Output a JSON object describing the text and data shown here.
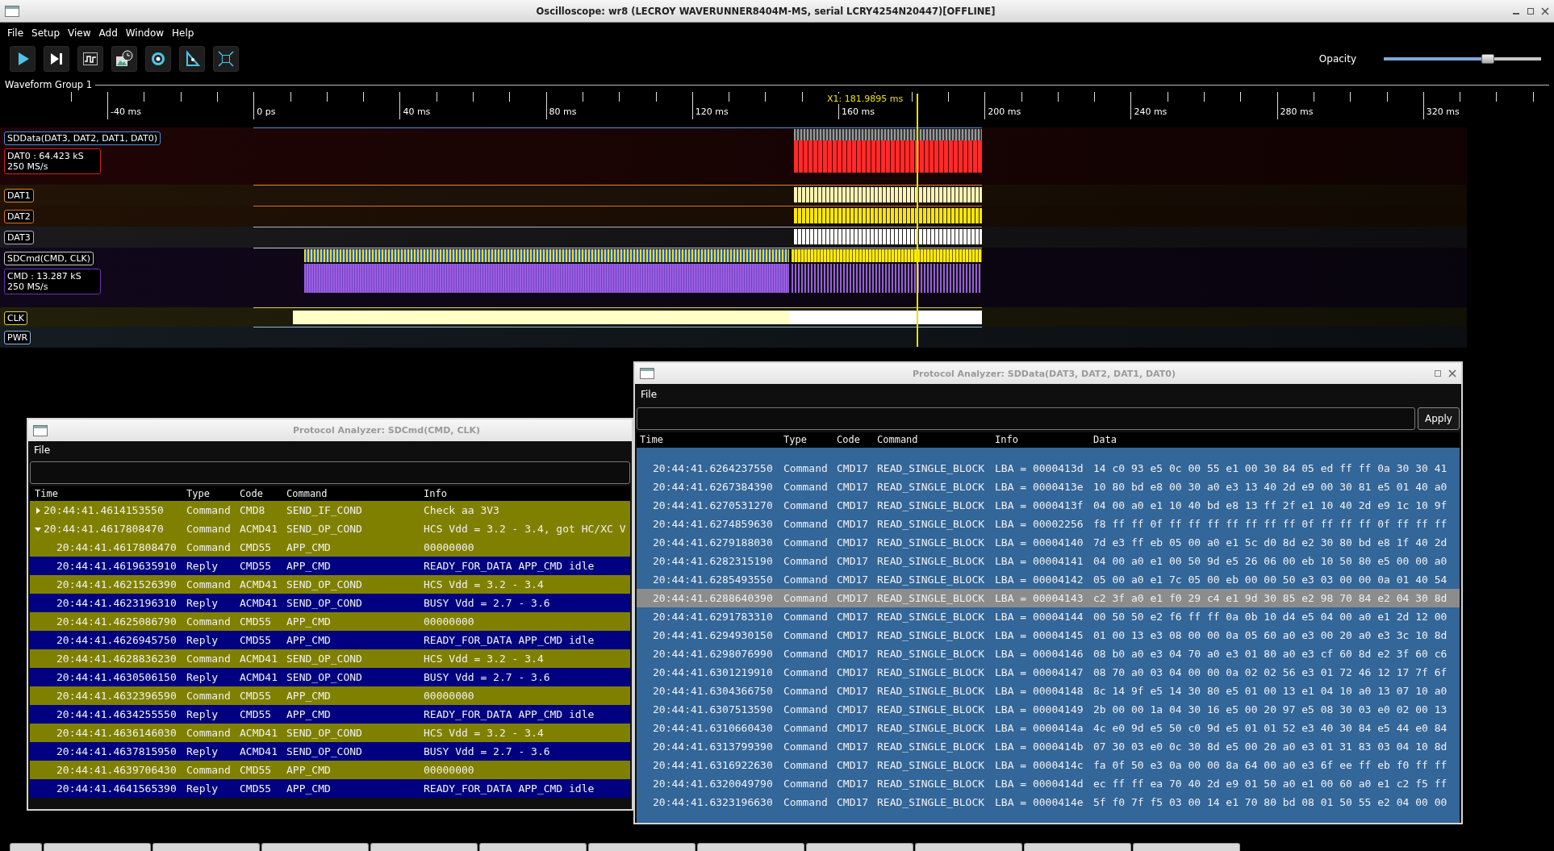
{
  "window": {
    "title": "Oscilloscope: wr8 (LECROY WAVERUNNER8404M-MS, serial LCRY4254N20447)[OFFLINE]"
  },
  "menu": [
    "File",
    "Setup",
    "View",
    "Add",
    "Window",
    "Help"
  ],
  "toolbar": {
    "opacity": {
      "label": "Opacity",
      "level": 0.66
    }
  },
  "waveform_group": {
    "title": "Waveform Group 1",
    "ruler": [
      "-40 ms",
      "0 ps",
      "40 ms",
      "80 ms",
      "120 ms",
      "160 ms",
      "200 ms",
      "240 ms",
      "280 ms",
      "320 ms"
    ],
    "cursor": {
      "label": "X1: 181.9895 ms"
    },
    "channels": [
      {
        "label": "SDData(DAT3, DAT2, DAT1, DAT0)",
        "kind": "data-bus",
        "color": "#4a90e2",
        "info": {
          "lines": [
            "DAT0 : 64.423 kS",
            "250 MS/s"
          ],
          "color": "#d42020"
        }
      },
      {
        "label": "DAT1",
        "kind": "data-line",
        "color": "#e08a30",
        "trace": {
          "color": "#fff3b0"
        }
      },
      {
        "label": "DAT2",
        "kind": "data-line",
        "color": "#e07020",
        "trace": {
          "color": "#ffe600"
        }
      },
      {
        "label": "DAT3",
        "kind": "data-line",
        "color": "#b0b0c8",
        "trace": {
          "color": "#ffffff"
        }
      },
      {
        "label": "SDCmd(CMD, CLK)",
        "kind": "cmd-bus",
        "color": "#c8c8c8",
        "info": {
          "lines": [
            "CMD : 13.287 kS",
            "250 MS/s"
          ],
          "color": "#6a34b0"
        }
      },
      {
        "label": "CLK",
        "kind": "clock",
        "color": "#e0d040"
      },
      {
        "label": "PWR",
        "kind": "power",
        "color": "#8ab8e0"
      }
    ]
  },
  "analyzers": [
    {
      "title": "Protocol Analyzer: SDCmd(CMD, CLK)",
      "menu": [
        "File"
      ],
      "columns": [
        "Time",
        "Type",
        "Code",
        "Command",
        "Info"
      ],
      "rows": [
        {
          "time": "20:44:41.4614153550",
          "type": "Command",
          "code": "CMD8",
          "command": "SEND_IF_COND",
          "info": "Check aa 3V3",
          "color": "#808000",
          "expanded": false
        },
        {
          "time": "20:44:41.4617808470",
          "type": "Command",
          "code": "ACMD41",
          "command": "SEND_OP_COND",
          "info": "HCS Vdd = 3.2 - 3.4, got HC/XC V",
          "color": "#808000",
          "expanded": true,
          "children": [
            {
              "time": "20:44:41.4617808470",
              "type": "Command",
              "code": "CMD55",
              "command": "APP_CMD",
              "info": "00000000",
              "color": "#808000"
            },
            {
              "time": "20:44:41.4619635910",
              "type": "Reply",
              "code": "CMD55",
              "command": "APP_CMD",
              "info": "READY_FOR_DATA APP_CMD idle",
              "color": "#000080"
            },
            {
              "time": "20:44:41.4621526390",
              "type": "Command",
              "code": "ACMD41",
              "command": "SEND_OP_COND",
              "info": "HCS Vdd = 3.2 - 3.4",
              "color": "#808000"
            },
            {
              "time": "20:44:41.4623196310",
              "type": "Reply",
              "code": "ACMD41",
              "command": "SEND_OP_COND",
              "info": "BUSY Vdd = 2.7 - 3.6",
              "color": "#000080"
            },
            {
              "time": "20:44:41.4625086790",
              "type": "Command",
              "code": "CMD55",
              "command": "APP_CMD",
              "info": "00000000",
              "color": "#808000"
            },
            {
              "time": "20:44:41.4626945750",
              "type": "Reply",
              "code": "CMD55",
              "command": "APP_CMD",
              "info": "READY_FOR_DATA APP_CMD idle",
              "color": "#000080"
            },
            {
              "time": "20:44:41.4628836230",
              "type": "Command",
              "code": "ACMD41",
              "command": "SEND_OP_COND",
              "info": "HCS Vdd = 3.2 - 3.4",
              "color": "#808000"
            },
            {
              "time": "20:44:41.4630506150",
              "type": "Reply",
              "code": "ACMD41",
              "command": "SEND_OP_COND",
              "info": "BUSY Vdd = 2.7 - 3.6",
              "color": "#000080"
            },
            {
              "time": "20:44:41.4632396590",
              "type": "Command",
              "code": "CMD55",
              "command": "APP_CMD",
              "info": "00000000",
              "color": "#808000"
            },
            {
              "time": "20:44:41.4634255550",
              "type": "Reply",
              "code": "CMD55",
              "command": "APP_CMD",
              "info": "READY_FOR_DATA APP_CMD idle",
              "color": "#000080"
            },
            {
              "time": "20:44:41.4636146030",
              "type": "Command",
              "code": "ACMD41",
              "command": "SEND_OP_COND",
              "info": "HCS Vdd = 3.2 - 3.4",
              "color": "#808000"
            },
            {
              "time": "20:44:41.4637815950",
              "type": "Reply",
              "code": "ACMD41",
              "command": "SEND_OP_COND",
              "info": "BUSY Vdd = 2.7 - 3.6",
              "color": "#000080"
            },
            {
              "time": "20:44:41.4639706430",
              "type": "Command",
              "code": "CMD55",
              "command": "APP_CMD",
              "info": "00000000",
              "color": "#808000"
            },
            {
              "time": "20:44:41.4641565390",
              "type": "Reply",
              "code": "CMD55",
              "command": "APP_CMD",
              "info": "READY_FOR_DATA APP_CMD idle",
              "color": "#000080"
            }
          ]
        }
      ]
    },
    {
      "title": "Protocol Analyzer: SDData(DAT3, DAT2, DAT1, DAT0)",
      "menu": [
        "File"
      ],
      "apply_button": "Apply",
      "columns": [
        "Time",
        "Type",
        "Code",
        "Command",
        "Info",
        "Data"
      ],
      "rows": [
        {
          "time": "20:44:41.6264237550",
          "type": "Command",
          "code": "CMD17",
          "command": "READ_SINGLE_BLOCK",
          "info": "LBA = 0000413d",
          "data": "14 c0 93 e5 0c 00 55 e1 00 30 84 05 ed ff ff 0a 30 30 41",
          "selected": false
        },
        {
          "time": "20:44:41.6267384390",
          "type": "Command",
          "code": "CMD17",
          "command": "READ_SINGLE_BLOCK",
          "info": "LBA = 0000413e",
          "data": "10 80 bd e8 00 30 a0 e3 13 40 2d e9 00 30 81 e5 01 40 a0",
          "selected": false
        },
        {
          "time": "20:44:41.6270531270",
          "type": "Command",
          "code": "CMD17",
          "command": "READ_SINGLE_BLOCK",
          "info": "LBA = 0000413f",
          "data": "04 00 a0 e1 10 40 bd e8 13 ff 2f e1 10 40 2d e9 1c 10 9f",
          "selected": false
        },
        {
          "time": "20:44:41.6274859630",
          "type": "Command",
          "code": "CMD17",
          "command": "READ_SINGLE_BLOCK",
          "info": "LBA = 00002256",
          "data": "f8 ff ff 0f ff ff ff ff ff ff ff 0f ff ff ff 0f ff ff ff",
          "selected": false
        },
        {
          "time": "20:44:41.6279188030",
          "type": "Command",
          "code": "CMD17",
          "command": "READ_SINGLE_BLOCK",
          "info": "LBA = 00004140",
          "data": "7d e3 ff eb 05 00 a0 e1 5c d0 8d e2 30 80 bd e8 1f 40 2d",
          "selected": false
        },
        {
          "time": "20:44:41.6282315190",
          "type": "Command",
          "code": "CMD17",
          "command": "READ_SINGLE_BLOCK",
          "info": "LBA = 00004141",
          "data": "04 00 a0 e1 00 50 9d e5 26 06 00 eb 10 50 80 e5 00 00 a0",
          "selected": false
        },
        {
          "time": "20:44:41.6285493550",
          "type": "Command",
          "code": "CMD17",
          "command": "READ_SINGLE_BLOCK",
          "info": "LBA = 00004142",
          "data": "05 00 a0 e1 7c 05 00 eb 00 00 50 e3 03 00 00 0a 01 40 54",
          "selected": false
        },
        {
          "time": "20:44:41.6288640390",
          "type": "Command",
          "code": "CMD17",
          "command": "READ_SINGLE_BLOCK",
          "info": "LBA = 00004143",
          "data": "c2 3f a0 e1 f0 29 c4 e1 9d 30 85 e2 98 70 84 e2 04 30 8d",
          "selected": true
        },
        {
          "time": "20:44:41.6291783310",
          "type": "Command",
          "code": "CMD17",
          "command": "READ_SINGLE_BLOCK",
          "info": "LBA = 00004144",
          "data": "00 50 50 e2 f6 ff ff 0a 0b 10 d4 e5 04 00 a0 e1 2d 12 00",
          "selected": false
        },
        {
          "time": "20:44:41.6294930150",
          "type": "Command",
          "code": "CMD17",
          "command": "READ_SINGLE_BLOCK",
          "info": "LBA = 00004145",
          "data": "01 00 13 e3 08 00 00 0a 05 60 a0 e3 00 20 a0 e3 3c 10 8d",
          "selected": false
        },
        {
          "time": "20:44:41.6298076990",
          "type": "Command",
          "code": "CMD17",
          "command": "READ_SINGLE_BLOCK",
          "info": "LBA = 00004146",
          "data": "08 b0 a0 e3 04 70 a0 e3 01 80 a0 e3 cf 60 8d e2 3f 60 c6",
          "selected": false
        },
        {
          "time": "20:44:41.6301219910",
          "type": "Command",
          "code": "CMD17",
          "command": "READ_SINGLE_BLOCK",
          "info": "LBA = 00004147",
          "data": "08 70 a0 03 04 00 00 0a 02 02 56 e3 01 72 46 12 17 7f 6f",
          "selected": false
        },
        {
          "time": "20:44:41.6304366750",
          "type": "Command",
          "code": "CMD17",
          "command": "READ_SINGLE_BLOCK",
          "info": "LBA = 00004148",
          "data": "8c 14 9f e5 14 30 80 e5 01 00 13 e1 04 10 a0 13 07 10 a0",
          "selected": false
        },
        {
          "time": "20:44:41.6307513590",
          "type": "Command",
          "code": "CMD17",
          "command": "READ_SINGLE_BLOCK",
          "info": "LBA = 00004149",
          "data": "2b 00 00 1a 04 30 16 e5 00 20 97 e5 08 30 03 e0 02 00 13",
          "selected": false
        },
        {
          "time": "20:44:41.6310660430",
          "type": "Command",
          "code": "CMD17",
          "command": "READ_SINGLE_BLOCK",
          "info": "LBA = 0000414a",
          "data": "4c e0 9d e5 50 c0 9d e5 01 01 52 e3 40 30 84 e5 44 e0 84",
          "selected": false
        },
        {
          "time": "20:44:41.6313799390",
          "type": "Command",
          "code": "CMD17",
          "command": "READ_SINGLE_BLOCK",
          "info": "LBA = 0000414b",
          "data": "07 30 03 e0 0c 30 8d e5 00 20 a0 e3 01 31 83 03 04 10 8d",
          "selected": false
        },
        {
          "time": "20:44:41.6316922630",
          "type": "Command",
          "code": "CMD17",
          "command": "READ_SINGLE_BLOCK",
          "info": "LBA = 0000414c",
          "data": "fa 0f 50 e3 0a 00 00 8a 64 00 a0 e3 6f ee ff eb f0 ff ff",
          "selected": false
        },
        {
          "time": "20:44:41.6320049790",
          "type": "Command",
          "code": "CMD17",
          "command": "READ_SINGLE_BLOCK",
          "info": "LBA = 0000414d",
          "data": "ec ff ff ea 70 40 2d e9 01 50 a0 e1 00 60 a0 e1 c2 f5 ff",
          "selected": false
        },
        {
          "time": "20:44:41.6323196630",
          "type": "Command",
          "code": "CMD17",
          "command": "READ_SINGLE_BLOCK",
          "info": "LBA = 0000414e",
          "data": "5f f0 7f f5 03 00 14 e1 70 80 bd 08 01 50 55 e2 04 00 00",
          "selected": false
        }
      ]
    }
  ]
}
